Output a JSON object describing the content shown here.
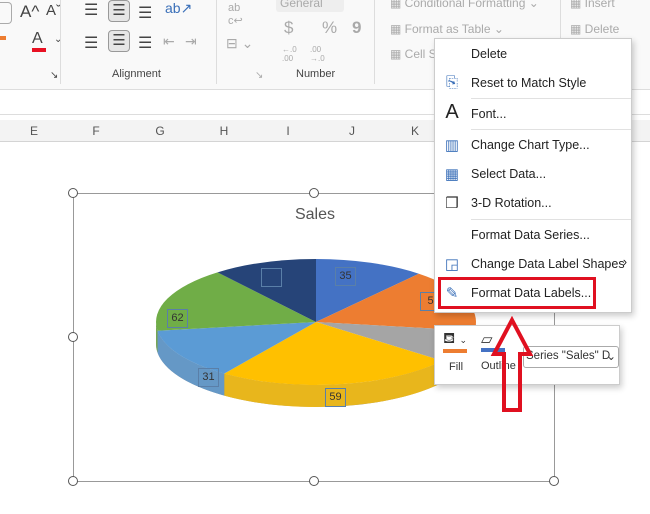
{
  "ribbon": {
    "font_grow": "A^",
    "font_shrink": "Aˇ",
    "font_color": "A",
    "alignment_group": "Alignment",
    "number_format": "General",
    "currency": "$",
    "percent": "%",
    "comma": "9",
    "inc_decimal": "←.0 .00",
    "dec_decimal": ".00 →.0",
    "number_group": "Number",
    "conditional_formatting": "Conditional Formatting",
    "format_as_table": "Format as Table",
    "cell_styles": "Cell S",
    "insert": "Insert",
    "delete": "Delete",
    "colors": {
      "font_color": "#e81123",
      "fill_color": "#ed7d31"
    }
  },
  "columns": [
    "E",
    "F",
    "G",
    "H",
    "I",
    "J",
    "K"
  ],
  "chart": {
    "title": "Sales",
    "type": "3d-pie",
    "data_labels": [
      "35",
      "5",
      "62",
      "31",
      "59"
    ],
    "slice_colors": [
      "#4472c4",
      "#ed7d31",
      "#a5a5a5",
      "#ffc000",
      "#5b9bd5",
      "#70ad47",
      "#264478"
    ]
  },
  "context_menu": {
    "items": [
      {
        "label": "Delete",
        "icon": ""
      },
      {
        "label": "Reset to Match Style",
        "icon": "reset-style-icon"
      },
      {
        "label": "Font...",
        "icon": "font-icon"
      },
      {
        "label": "Change Chart Type...",
        "icon": "chart-type-icon"
      },
      {
        "label": "Select Data...",
        "icon": "select-data-icon"
      },
      {
        "label": "3-D Rotation...",
        "icon": "rotation-icon"
      },
      {
        "label": "Format Data Series...",
        "icon": ""
      },
      {
        "label": "Change Data Label Shapes",
        "icon": "label-shapes-icon"
      },
      {
        "label": "Format Data Labels...",
        "icon": "format-labels-icon"
      }
    ]
  },
  "mini_toolbar": {
    "fill": "Fill",
    "outline": "Outline",
    "series_select": "Series \"Sales\" D",
    "fill_color": "#ed7d31",
    "outline_color": "#4472c4"
  },
  "annotation": {
    "highlight_color": "#e01020"
  }
}
